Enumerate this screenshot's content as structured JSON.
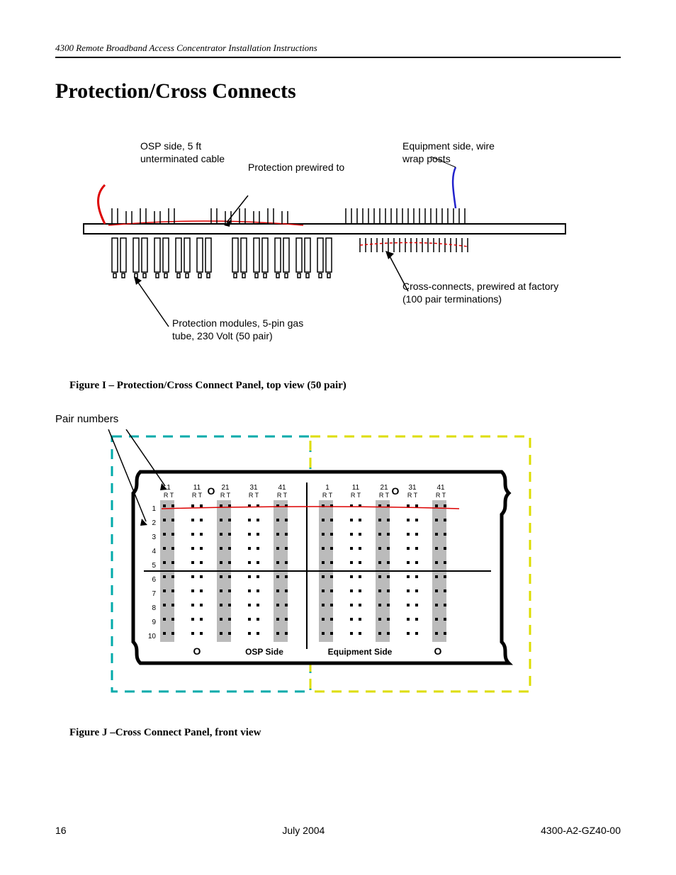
{
  "header": {
    "running": "4300 Remote Broadband Access Concentrator  Installation Instructions"
  },
  "title": "Protection/Cross Connects",
  "figI": {
    "caption": "Figure I – Protection/Cross Connect Panel, top view (50 pair)",
    "labels": {
      "osp": "OSP side, 5 ft unterminated cable",
      "prot_prewired": "Protection prewired to",
      "equip": "Equipment side, wire wrap posts",
      "modules": "Protection modules, 5-pin gas tube, 230 Volt (50 pair)",
      "cross": "Cross-connects, prewired at factory (100 pair terminations)"
    }
  },
  "figJ": {
    "pair_label": "Pair numbers",
    "caption": "Figure J –Cross Connect Panel, front view",
    "col_headers": [
      "1",
      "11",
      "21",
      "31",
      "41",
      "1",
      "11",
      "21",
      "31",
      "41"
    ],
    "rt": "R  T",
    "rows": [
      "1",
      "2",
      "3",
      "4",
      "5",
      "6",
      "7",
      "8",
      "9",
      "10"
    ],
    "osp_side": "OSP Side",
    "equip_side": "Equipment Side"
  },
  "footer": {
    "page": "16",
    "date": "July 2004",
    "docnum": "4300-A2-GZ40-00"
  }
}
